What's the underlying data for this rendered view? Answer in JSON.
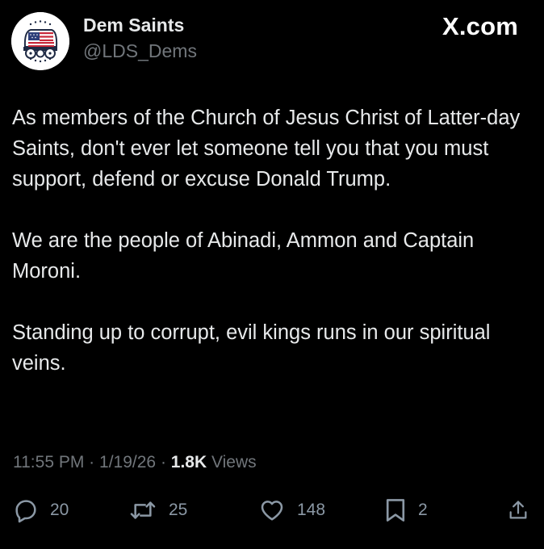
{
  "author": {
    "display_name": "Dem Saints",
    "handle": "@LDS_Dems",
    "avatar_icon": "covered-wagon-flag-logo"
  },
  "brand": {
    "label": "X.com"
  },
  "tweet": {
    "paragraphs": [
      "As members of the Church of Jesus Christ of Latter-day Saints, don't ever let someone tell you that you must support, defend or excuse Donald Trump.",
      "We are the people of Abinadi, Ammon and Captain Moroni.",
      "Standing up to corrupt, evil kings runs in our spiritual veins."
    ]
  },
  "meta": {
    "time": "11:55 PM",
    "date": "1/19/26",
    "separator": "·",
    "views_count": "1.8K",
    "views_label": "Views"
  },
  "actions": {
    "replies": {
      "icon": "reply-icon",
      "count": "20"
    },
    "reposts": {
      "icon": "repost-icon",
      "count": "25"
    },
    "likes": {
      "icon": "like-icon",
      "count": "148"
    },
    "bookmarks": {
      "icon": "bookmark-icon",
      "count": "2"
    },
    "share": {
      "icon": "share-icon"
    }
  },
  "colors": {
    "background": "#000000",
    "text_primary": "#e7e9ea",
    "text_secondary": "#71767b",
    "icon": "#8b98a5"
  }
}
